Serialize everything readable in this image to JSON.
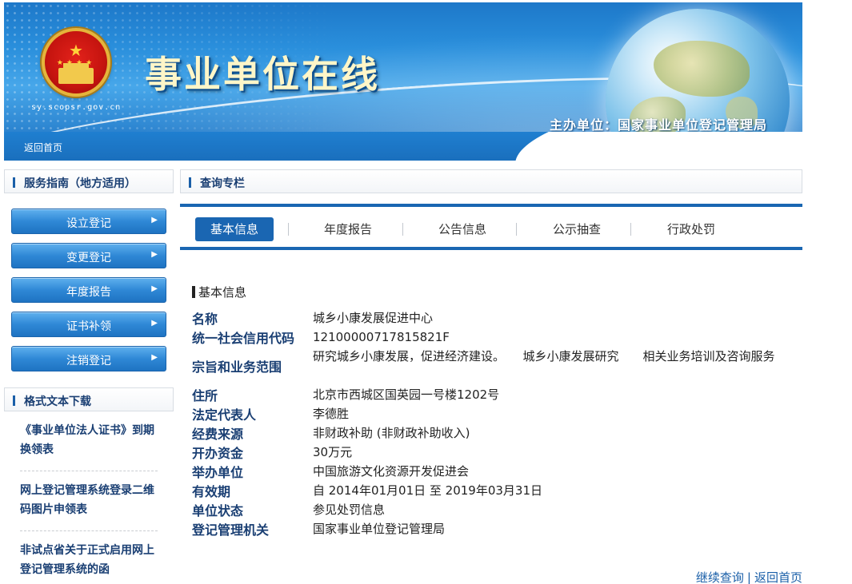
{
  "header": {
    "site_title": "事业单位在线",
    "site_domain": "sy.scopsr.gov.cn",
    "host_org": "主办单位：国家事业单位登记管理局"
  },
  "nav": {
    "home_link": "返回首页"
  },
  "sidebar": {
    "guide_title": "服务指南（地方适用）",
    "buttons": [
      {
        "label": "设立登记"
      },
      {
        "label": "变更登记"
      },
      {
        "label": "年度报告"
      },
      {
        "label": "证书补领"
      },
      {
        "label": "注销登记"
      }
    ],
    "downloads_title": "格式文本下载",
    "downloads": [
      {
        "label": "《事业单位法人证书》到期换领表"
      },
      {
        "label": "网上登记管理系统登录二维码图片申领表"
      },
      {
        "label": "非试点省关于正式启用网上登记管理系统的函"
      }
    ]
  },
  "main": {
    "query_title": "查询专栏",
    "tabs": [
      {
        "label": "基本信息",
        "active": true
      },
      {
        "label": "年度报告",
        "active": false
      },
      {
        "label": "公告信息",
        "active": false
      },
      {
        "label": "公示抽查",
        "active": false
      },
      {
        "label": "行政处罚",
        "active": false
      }
    ],
    "section_title": "基本信息",
    "fields": [
      {
        "label": "名称",
        "value": "城乡小康发展促进中心"
      },
      {
        "label": "统一社会信用代码",
        "value": "12100000717815821F"
      },
      {
        "label": "宗旨和业务范围",
        "value": "研究城乡小康发展，促进经济建设。　　城乡小康发展研究　　相关业务培训及咨询服务"
      },
      {
        "label": "住所",
        "value": "北京市西城区国英园一号楼1202号"
      },
      {
        "label": "法定代表人",
        "value": "李德胜"
      },
      {
        "label": "经费来源",
        "value": "非财政补助 (非财政补助收入)"
      },
      {
        "label": "开办资金",
        "value": "30万元"
      },
      {
        "label": "举办单位",
        "value": "中国旅游文化资源开发促进会"
      },
      {
        "label": "有效期",
        "value": "自 2014年01月01日 至 2019年03月31日"
      },
      {
        "label": "单位状态",
        "value": "参见处罚信息"
      },
      {
        "label": "登记管理机关",
        "value": "国家事业单位登记管理局"
      }
    ],
    "footer": {
      "continue_query": "继续查询",
      "separator": "|",
      "back_home": "返回首页"
    }
  },
  "colors": {
    "brand_blue": "#1a66b2",
    "label_navy": "#1a3f73",
    "link_blue": "#1a5fa8"
  }
}
